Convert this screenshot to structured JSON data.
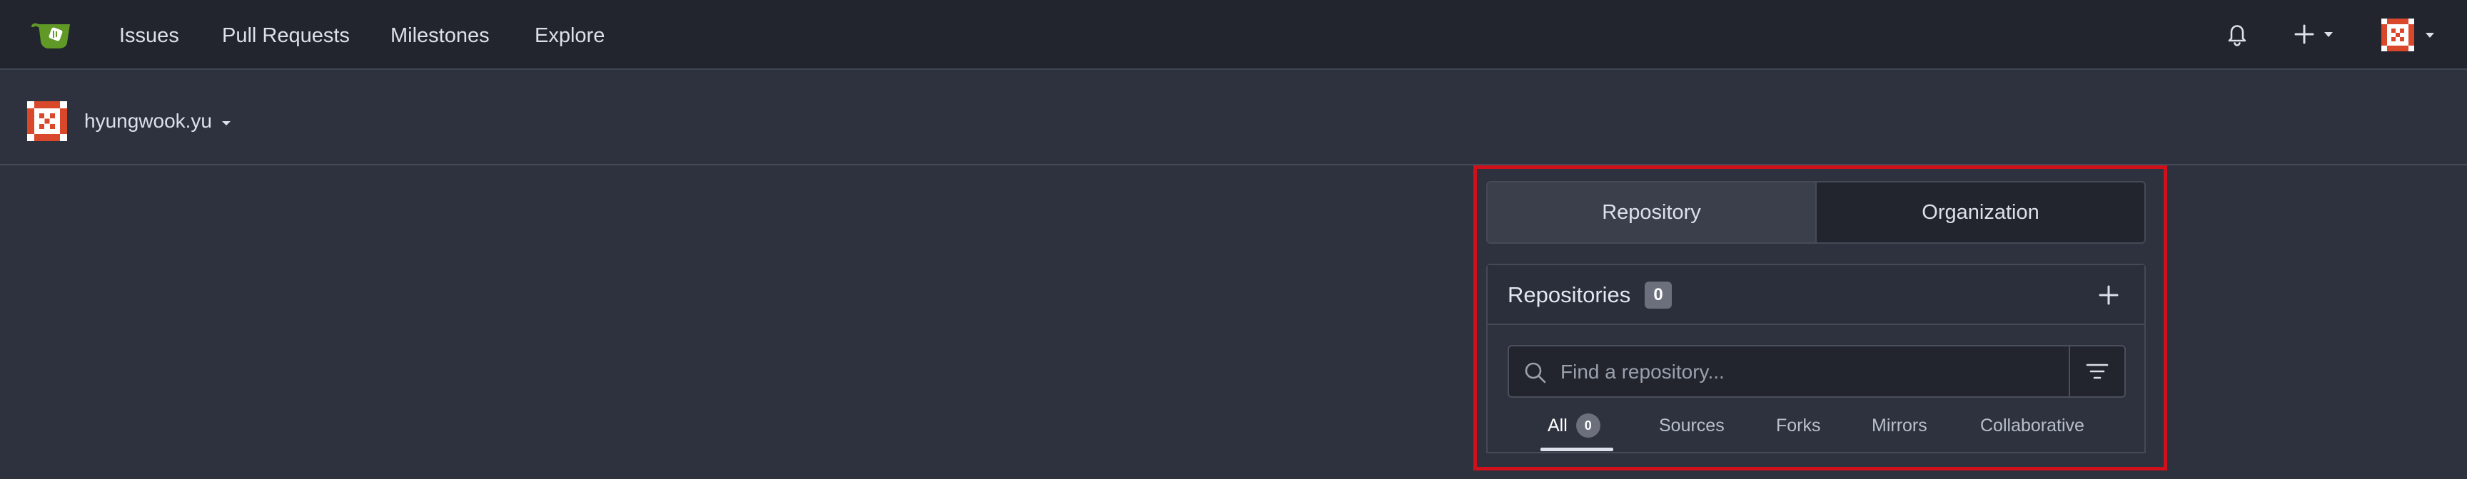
{
  "navbar": {
    "logo_icon": "gitea-tea-icon",
    "items": [
      {
        "label": "Issues"
      },
      {
        "label": "Pull Requests"
      },
      {
        "label": "Milestones"
      },
      {
        "label": "Explore"
      }
    ],
    "right": {
      "notifications_icon": "bell-icon",
      "create_icon": "plus-icon",
      "profile_icon": "avatar"
    }
  },
  "user": {
    "name": "hyungwook.yu"
  },
  "dashboard": {
    "toggle": {
      "repository_label": "Repository",
      "organization_label": "Organization",
      "active": "Repository"
    },
    "repos": {
      "title": "Repositories",
      "count": "0",
      "search_placeholder": "Find a repository...",
      "tabs": [
        {
          "label": "All",
          "count": "0",
          "active": true
        },
        {
          "label": "Sources"
        },
        {
          "label": "Forks"
        },
        {
          "label": "Mirrors"
        },
        {
          "label": "Collaborative"
        }
      ]
    }
  },
  "colors": {
    "navbar_bg": "#22252e",
    "page_bg": "#2e323e",
    "logo_green": "#609926",
    "highlight_red": "#d0101a",
    "avatar_red": "#d9482b"
  }
}
